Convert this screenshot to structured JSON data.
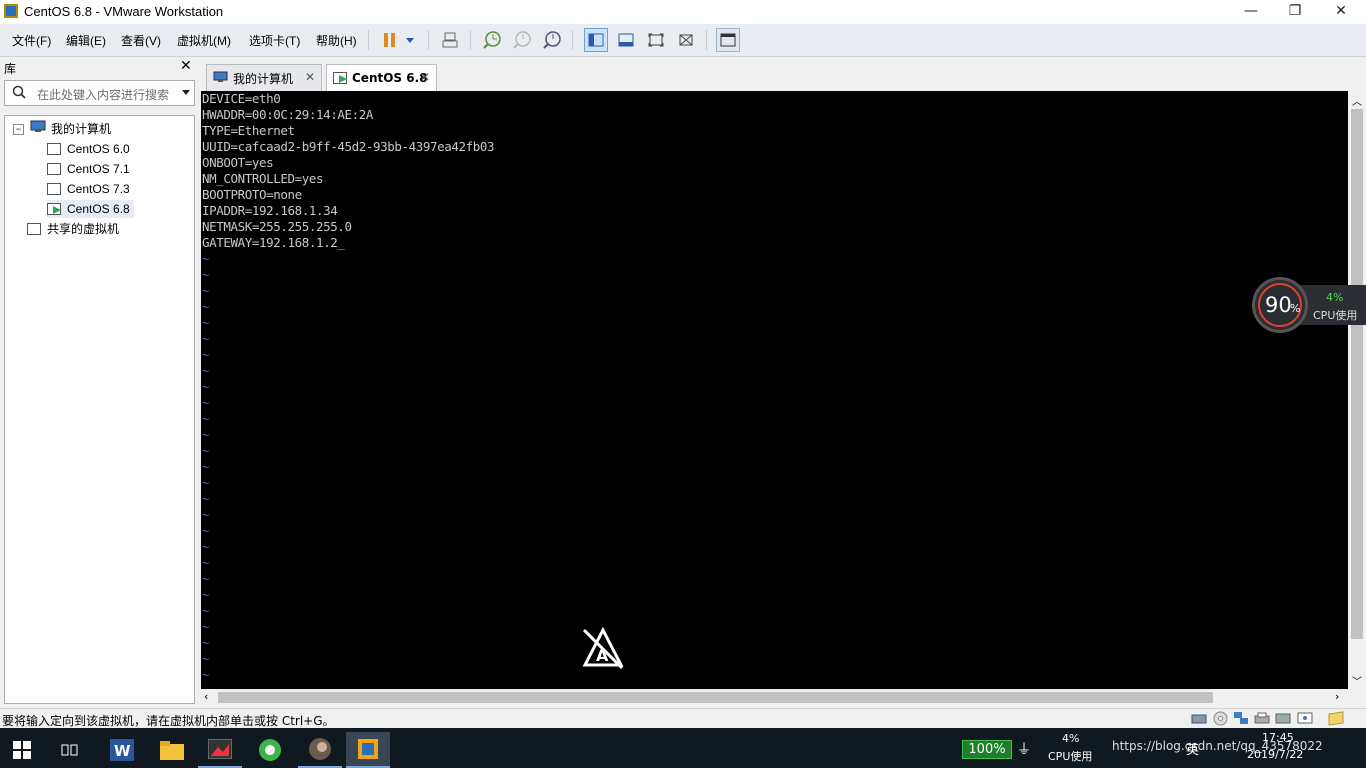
{
  "window": {
    "title": "CentOS 6.8 - VMware Workstation",
    "minimize": "—",
    "maximize": "❐",
    "close": "✕"
  },
  "menu": [
    {
      "label": "文件(F)"
    },
    {
      "label": "编辑(E)"
    },
    {
      "label": "查看(V)"
    },
    {
      "label": "虚拟机(M)"
    },
    {
      "label": "选项卡(T)"
    },
    {
      "label": "帮助(H)"
    }
  ],
  "library": {
    "title": "库",
    "search_placeholder": "在此处键入内容进行搜索",
    "root": "我的计算机",
    "vms": [
      {
        "label": "CentOS 6.0"
      },
      {
        "label": "CentOS 7.1"
      },
      {
        "label": "CentOS 7.3"
      },
      {
        "label": "CentOS 6.8"
      }
    ],
    "shared": "共享的虚拟机"
  },
  "tabs": [
    {
      "label": "我的计算机"
    },
    {
      "label": "CentOS 6.8"
    }
  ],
  "console": {
    "lines": [
      "DEVICE=eth0",
      "HWADDR=00:0C:29:14:AE:2A",
      "TYPE=Ethernet",
      "UUID=cafcaad2-b9ff-45d2-93bb-4397ea42fb03",
      "ONBOOT=yes",
      "NM_CONTROLLED=yes",
      "BOOTPROTO=none",
      "IPADDR=192.168.1.34",
      "NETMASK=255.255.255.0",
      "GATEWAY=192.168.1.2_"
    ],
    "tilde": "~"
  },
  "cpu_widget": {
    "percent": "90",
    "unit": "%",
    "cpu_value": "4%",
    "cpu_label": "CPU使用"
  },
  "status": {
    "message": "要将输入定向到该虚拟机，请在虚拟机内部单击或按 Ctrl+G。"
  },
  "taskbar": {
    "battery": "100%",
    "cpu_value": "4%",
    "cpu_label": "CPU使用",
    "url": "https://blog.csdn.net/qq_43578022",
    "ime": "英",
    "time": "17:45",
    "date": "2019/7/22"
  },
  "colors": {
    "console_bg": "#000000",
    "console_text": "#c8c8c8",
    "tilde": "#3a6bd9",
    "taskbar": "#101820",
    "accent": "#0a64ad"
  }
}
